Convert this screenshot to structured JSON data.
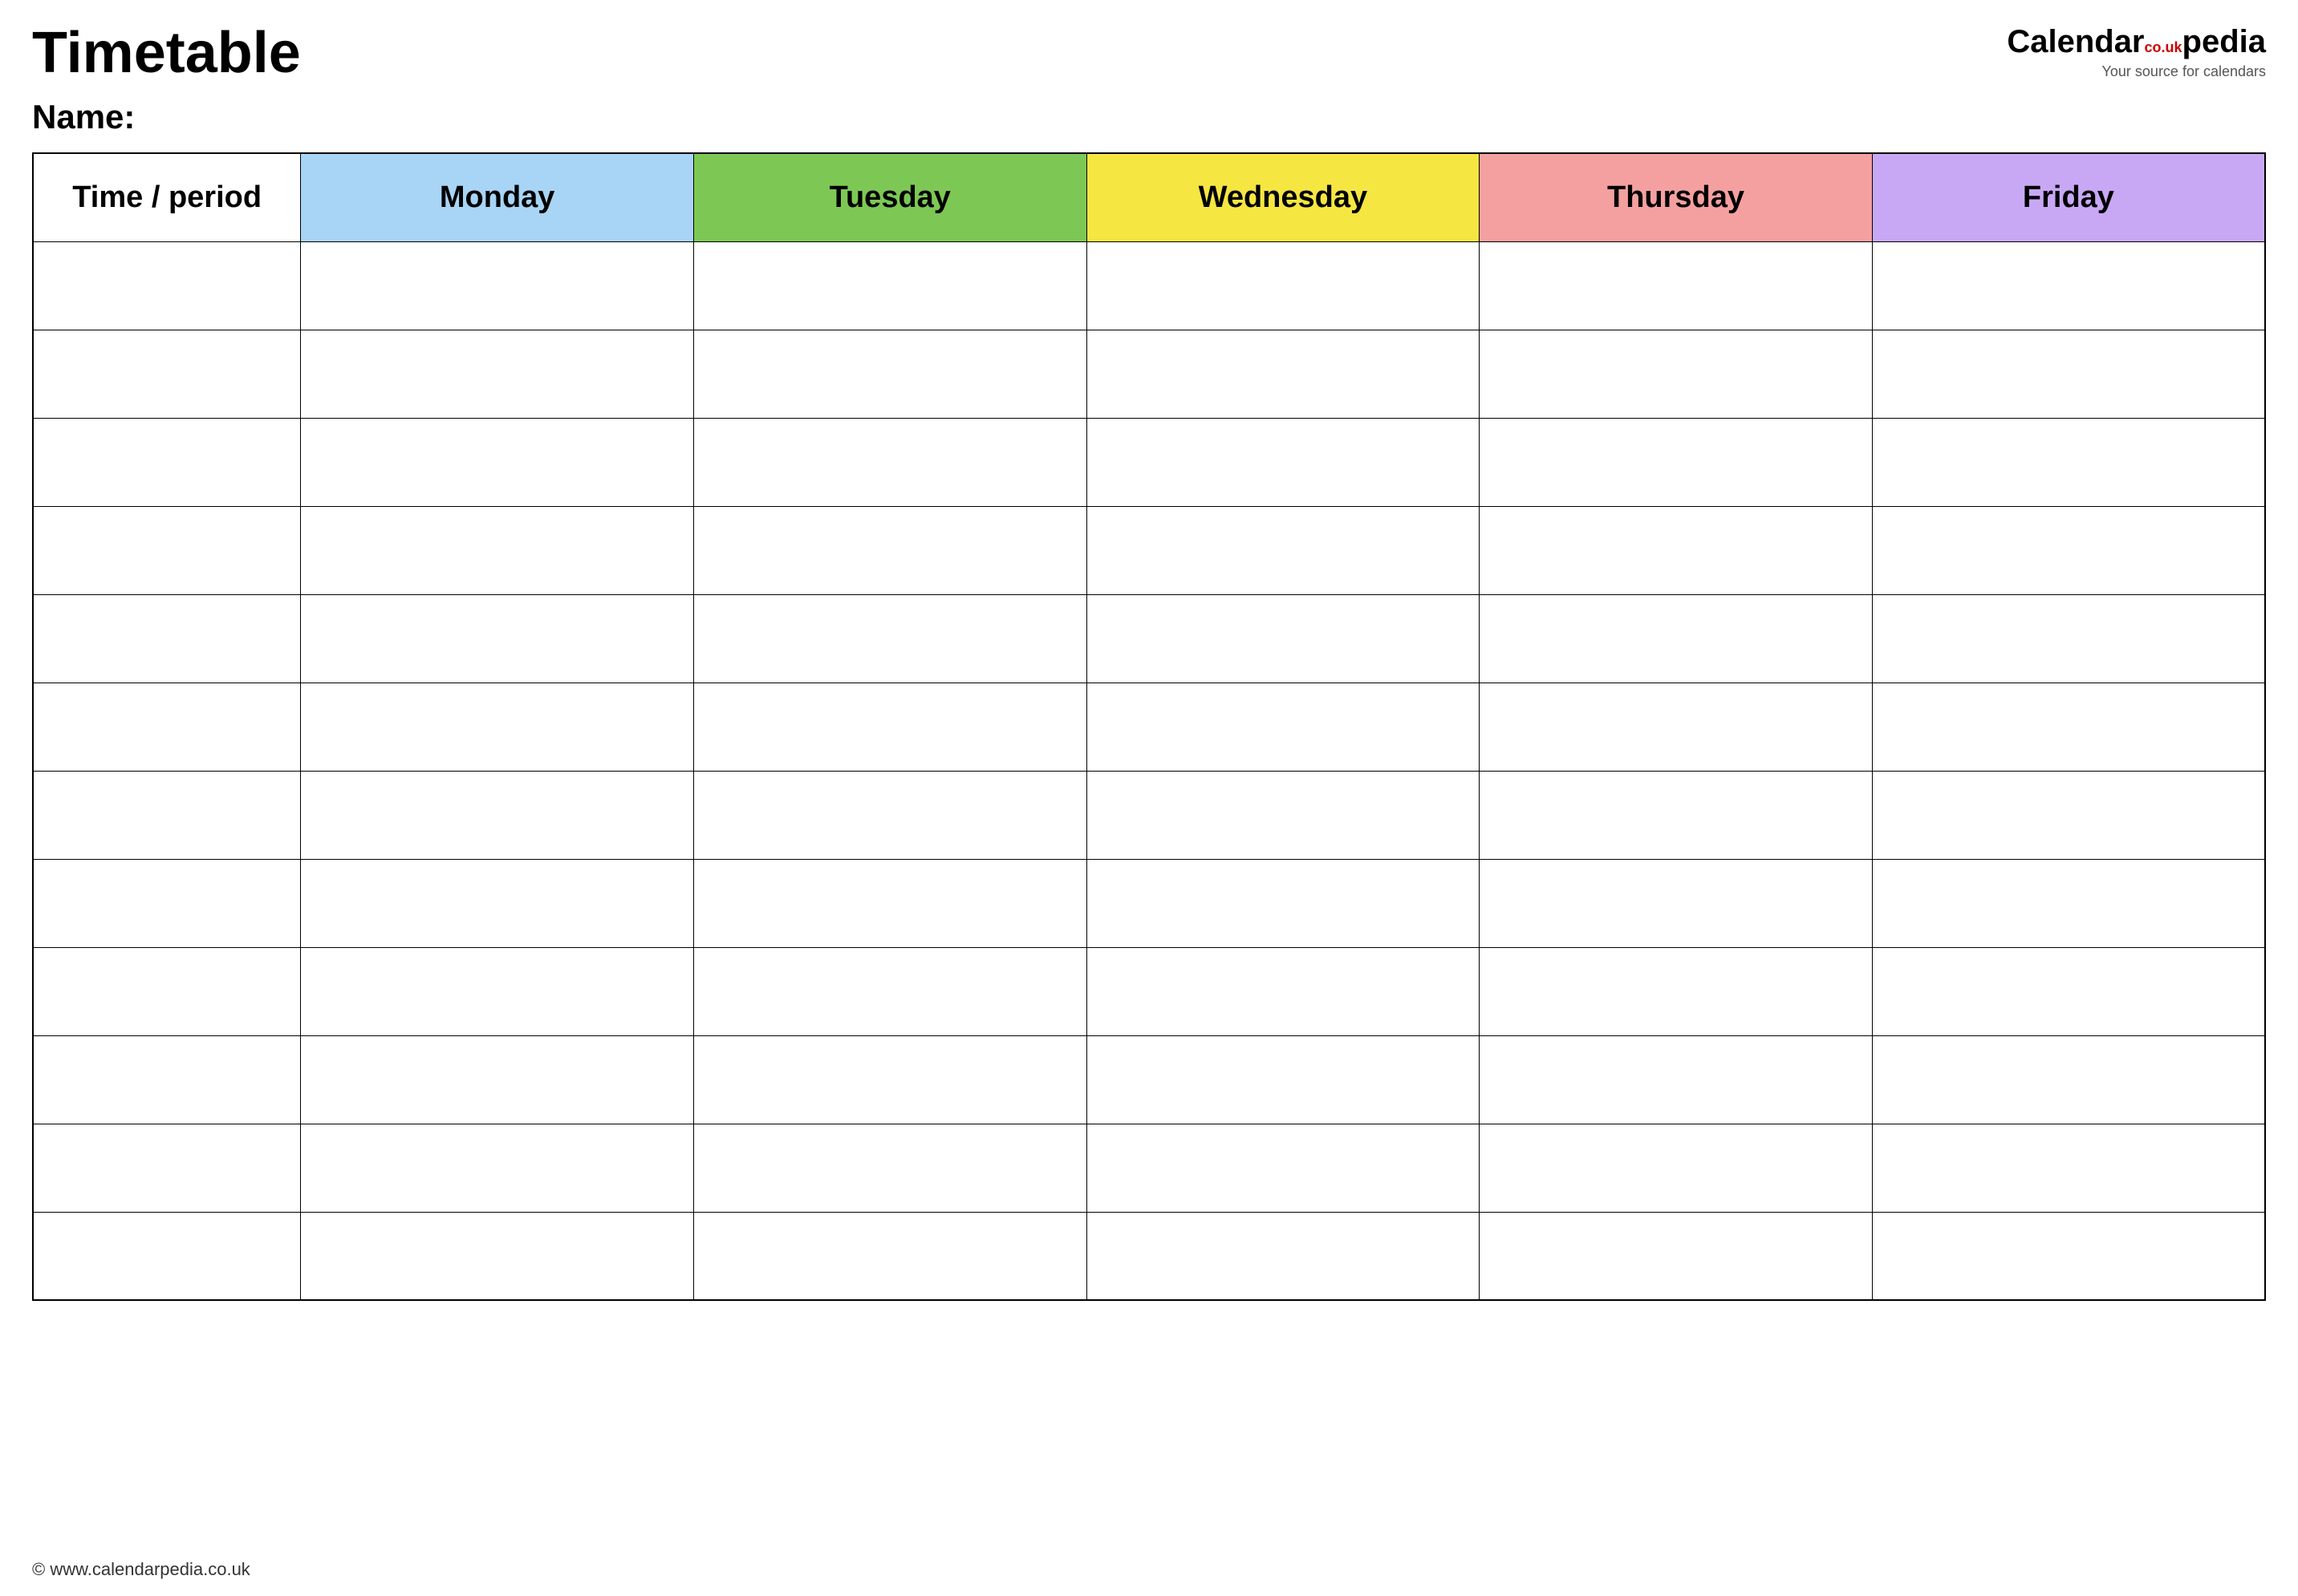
{
  "header": {
    "title": "Timetable",
    "logo_calendar": "Calendar",
    "logo_pedia": "pedia",
    "logo_sup": "co.uk",
    "logo_tagline": "Your source for calendars"
  },
  "name_label": "Name:",
  "table": {
    "columns": [
      {
        "id": "time",
        "label": "Time / period",
        "color": "#ffffff"
      },
      {
        "id": "monday",
        "label": "Monday",
        "color": "#a8d4f5"
      },
      {
        "id": "tuesday",
        "label": "Tuesday",
        "color": "#7dc855"
      },
      {
        "id": "wednesday",
        "label": "Wednesday",
        "color": "#f5e642"
      },
      {
        "id": "thursday",
        "label": "Thursday",
        "color": "#f5a0a0"
      },
      {
        "id": "friday",
        "label": "Friday",
        "color": "#c8a8f5"
      }
    ],
    "row_count": 12
  },
  "footer": {
    "url": "© www.calendarpedia.co.uk"
  }
}
